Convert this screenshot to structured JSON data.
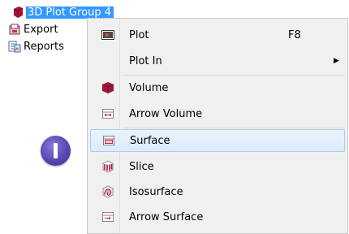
{
  "tree": {
    "plot_group": {
      "label": "3D Plot Group 4",
      "icon": "plot-group-icon"
    },
    "export": {
      "label": "Export",
      "icon": "export-icon"
    },
    "reports": {
      "label": "Reports",
      "icon": "reports-icon"
    }
  },
  "menu": {
    "items": [
      {
        "label": "Plot",
        "shortcut": "F8",
        "icon": "plot-icon"
      },
      {
        "label": "Plot In",
        "submenu_arrow": "▶"
      },
      {
        "label": "Volume",
        "icon": "volume-icon"
      },
      {
        "label": "Arrow Volume",
        "icon": "arrow-volume-icon"
      },
      {
        "label": "Surface",
        "icon": "surface-icon",
        "highlighted": true
      },
      {
        "label": "Slice",
        "icon": "slice-icon"
      },
      {
        "label": "Isosurface",
        "icon": "isosurface-icon"
      },
      {
        "label": "Arrow Surface",
        "icon": "arrow-surface-icon"
      }
    ]
  },
  "colors": {
    "selection": "#3399ff",
    "menu_background": "#f0f0f0",
    "highlight_border": "#a8cdf0",
    "volume_red": "#a3163a",
    "step_marker": "#5846b5"
  }
}
